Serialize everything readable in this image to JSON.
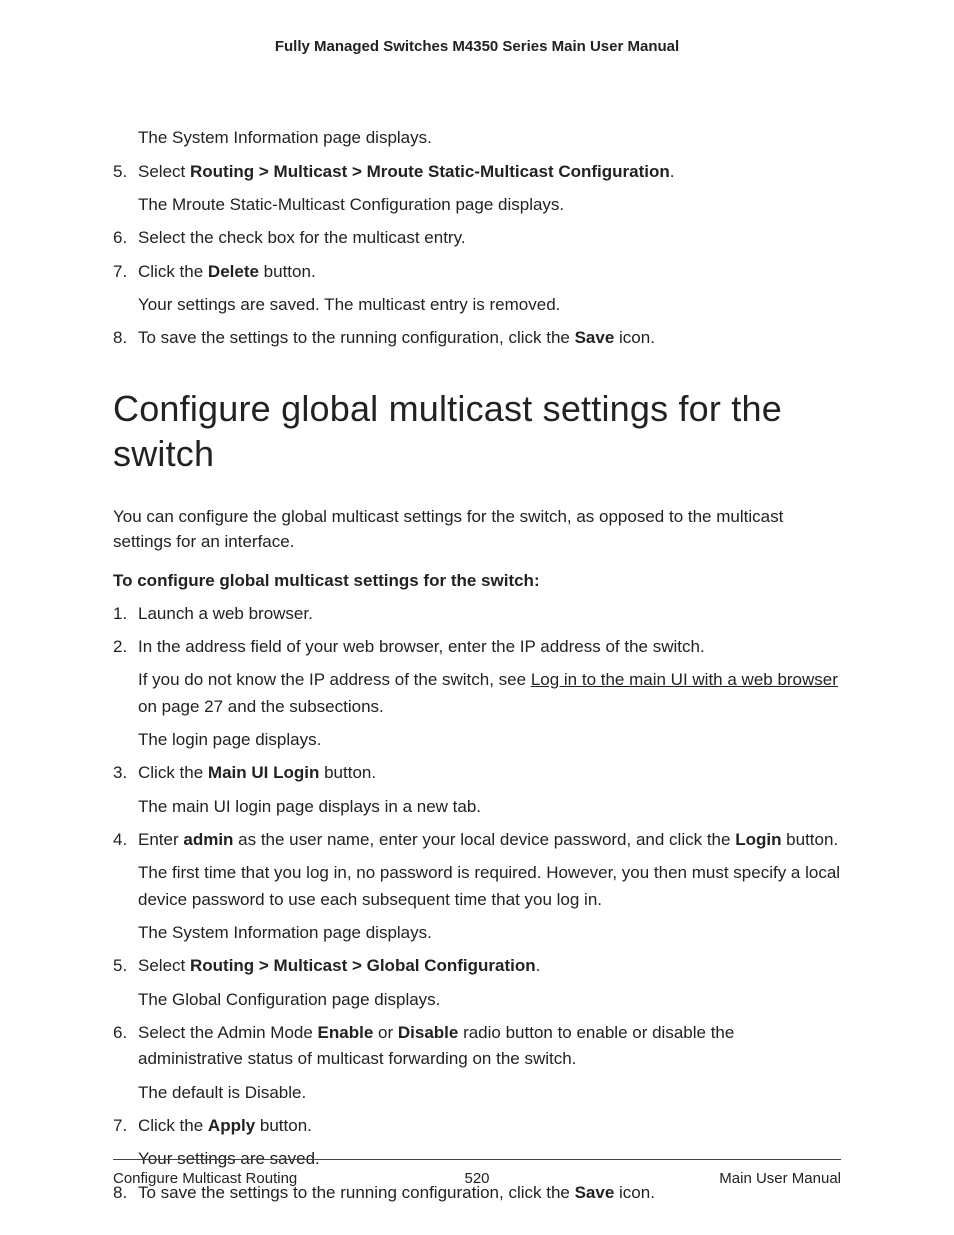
{
  "header": {
    "title": "Fully Managed Switches M4350 Series Main User Manual"
  },
  "section1": {
    "preText": "The System Information page displays.",
    "items": [
      {
        "num": "5.",
        "prefix": "Select ",
        "bold": "Routing > Multicast > Mroute Static-Multicast Configuration",
        "suffix": ".",
        "sub": "The Mroute Static-Multicast Configuration page displays."
      },
      {
        "num": "6.",
        "text": "Select the check box for the multicast entry."
      },
      {
        "num": "7.",
        "prefix": "Click the ",
        "bold": "Delete",
        "suffix": " button.",
        "sub": "Your settings are saved. The multicast entry is removed."
      },
      {
        "num": "8.",
        "prefix": "To save the settings to the running configuration, click the ",
        "bold": "Save",
        "suffix": " icon."
      }
    ]
  },
  "heading": "Configure global multicast settings for the switch",
  "intro": "You can configure the global multicast settings for the switch, as opposed to the multicast settings for an interface.",
  "subheading": "To configure global multicast settings for the switch:",
  "section2": {
    "items": [
      {
        "num": "1.",
        "text": "Launch a web browser."
      },
      {
        "num": "2.",
        "text": "In the address field of your web browser, enter the IP address of the switch.",
        "sub1_prefix": "If you do not know the IP address of the switch, see ",
        "sub1_link": "Log in to the main UI with a web browser",
        "sub1_suffix": " on page 27 and the subsections.",
        "sub2": "The login page displays."
      },
      {
        "num": "3.",
        "prefix": "Click the ",
        "bold": "Main UI Login",
        "suffix": " button.",
        "sub": "The main UI login page displays in a new tab."
      },
      {
        "num": "4.",
        "prefix": "Enter ",
        "bold": "admin",
        "mid": " as the user name, enter your local device password, and click the ",
        "bold2": "Login",
        "suffix": " button.",
        "sub": "The first time that you log in, no password is required. However, you then must specify a local device password to use each subsequent time that you log in.",
        "sub2": "The System Information page displays."
      },
      {
        "num": "5.",
        "prefix": "Select ",
        "bold": "Routing > Multicast > Global Configuration",
        "suffix": ".",
        "sub": "The Global Configuration page displays."
      },
      {
        "num": "6.",
        "prefix": "Select the Admin Mode ",
        "bold": "Enable",
        "mid": " or ",
        "bold2": "Disable",
        "suffix": " radio button to enable or disable the administrative status of multicast forwarding on the switch.",
        "sub": "The default is Disable."
      },
      {
        "num": "7.",
        "prefix": "Click the ",
        "bold": "Apply",
        "suffix": " button.",
        "sub": "Your settings are saved."
      },
      {
        "num": "8.",
        "prefix": "To save the settings to the running configuration, click the ",
        "bold": "Save",
        "suffix": " icon."
      }
    ]
  },
  "footer": {
    "left": "Configure Multicast Routing",
    "center": "520",
    "right": "Main User Manual"
  }
}
